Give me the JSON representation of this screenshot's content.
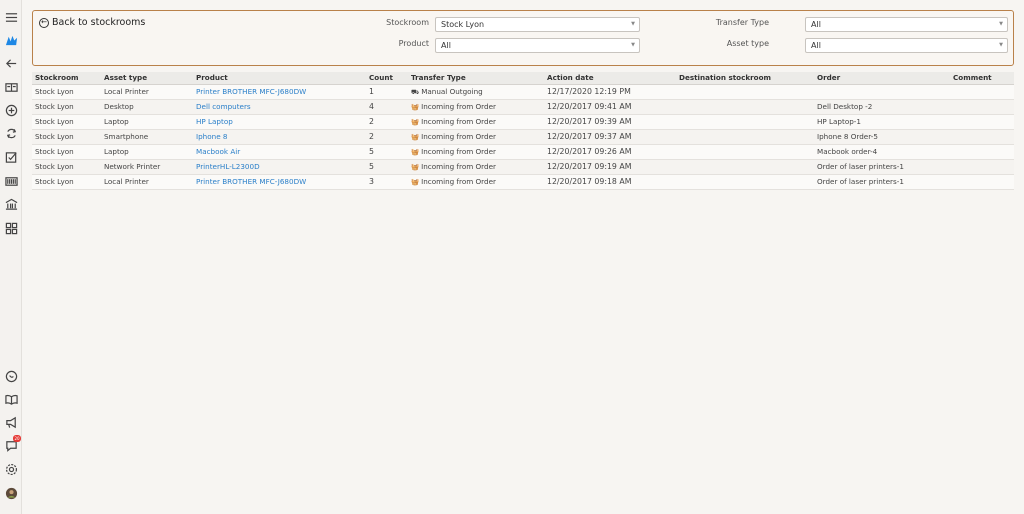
{
  "sidebar": {
    "items": [
      {
        "icon": "hamburger-menu-icon"
      },
      {
        "icon": "brand-logo-icon"
      },
      {
        "icon": "arrow-left-icon"
      },
      {
        "icon": "id-card-icon"
      },
      {
        "icon": "add-circle-icon"
      },
      {
        "icon": "sync-icon"
      },
      {
        "icon": "checkbox-icon"
      },
      {
        "icon": "barcode-icon"
      },
      {
        "icon": "bank-icon"
      },
      {
        "icon": "apps-grid-icon"
      },
      {
        "icon": "chat-icon"
      },
      {
        "icon": "book-icon"
      },
      {
        "icon": "megaphone-icon"
      },
      {
        "icon": "notifications-icon",
        "badge": "20"
      },
      {
        "icon": "settings-icon"
      },
      {
        "icon": "avatar-icon"
      }
    ]
  },
  "filters": {
    "back_label": "Back to stockrooms",
    "stockroom_label": "Stockroom",
    "stockroom_value": "Stock Lyon",
    "product_label": "Product",
    "product_value": "All",
    "transfer_type_label": "Transfer Type",
    "transfer_type_value": "All",
    "asset_type_label": "Asset type",
    "asset_type_value": "All"
  },
  "table": {
    "headers": [
      "Stockroom",
      "Asset type",
      "Product",
      "Count",
      "Transfer Type",
      "Action date",
      "Destination stockroom",
      "Order",
      "Comment"
    ],
    "rows": [
      {
        "stockroom": "Stock Lyon",
        "asset_type": "Local Printer",
        "product": "Printer BROTHER MFC-J680DW",
        "count": "1",
        "transfer_type": "Manual Outgoing",
        "transfer_icon": "truck-icon",
        "action_date": "12/17/2020 12:19 PM",
        "destination": "",
        "order": "",
        "comment": ""
      },
      {
        "stockroom": "Stock Lyon",
        "asset_type": "Desktop",
        "product": "Dell computers",
        "count": "4",
        "transfer_type": "Incoming from Order",
        "transfer_icon": "basket-icon",
        "action_date": "12/20/2017 09:41 AM",
        "destination": "",
        "order": "Dell Desktop -2",
        "comment": ""
      },
      {
        "stockroom": "Stock Lyon",
        "asset_type": "Laptop",
        "product": "HP Laptop",
        "count": "2",
        "transfer_type": "Incoming from Order",
        "transfer_icon": "basket-icon",
        "action_date": "12/20/2017 09:39 AM",
        "destination": "",
        "order": "HP Laptop-1",
        "comment": ""
      },
      {
        "stockroom": "Stock Lyon",
        "asset_type": "Smartphone",
        "product": "Iphone 8",
        "count": "2",
        "transfer_type": "Incoming from Order",
        "transfer_icon": "basket-icon",
        "action_date": "12/20/2017 09:37 AM",
        "destination": "",
        "order": "Iphone 8 Order-5",
        "comment": ""
      },
      {
        "stockroom": "Stock Lyon",
        "asset_type": "Laptop",
        "product": "Macbook Air",
        "count": "5",
        "transfer_type": "Incoming from Order",
        "transfer_icon": "basket-icon",
        "action_date": "12/20/2017 09:26 AM",
        "destination": "",
        "order": "Macbook order-4",
        "comment": ""
      },
      {
        "stockroom": "Stock Lyon",
        "asset_type": "Network Printer",
        "product": "PrinterHL-L2300D",
        "count": "5",
        "transfer_type": "Incoming from Order",
        "transfer_icon": "basket-icon",
        "action_date": "12/20/2017 09:19 AM",
        "destination": "",
        "order": "Order of laser printers-1",
        "comment": ""
      },
      {
        "stockroom": "Stock Lyon",
        "asset_type": "Local Printer",
        "product": "Printer BROTHER MFC-J680DW",
        "count": "3",
        "transfer_type": "Incoming from Order",
        "transfer_icon": "basket-icon",
        "action_date": "12/20/2017 09:18 AM",
        "destination": "",
        "order": "Order of laser printers-1",
        "comment": ""
      }
    ]
  }
}
